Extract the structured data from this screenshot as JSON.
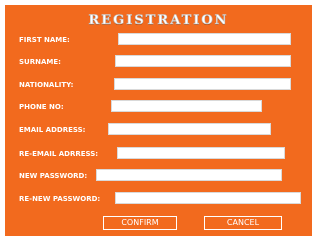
{
  "form": {
    "title": "REGISTRATION",
    "fields": [
      {
        "label": "FIRST NAME:",
        "value": ""
      },
      {
        "label": "SURNAME:",
        "value": ""
      },
      {
        "label": "NATIONALITY:",
        "value": ""
      },
      {
        "label": "PHONE NO:",
        "value": ""
      },
      {
        "label": "EMAIL ADDRESS:",
        "value": ""
      },
      {
        "label": "RE-EMAIL ADRRESS:",
        "value": ""
      },
      {
        "label": "NEW PASSWORD:",
        "value": ""
      },
      {
        "label": "RE-NEW PASSWORD:",
        "value": ""
      }
    ],
    "confirm_label": "CONFIRM",
    "cancel_label": "CANCEL"
  },
  "colors": {
    "panel_background": "#f26a1e",
    "text": "#ffffff",
    "page_background": "#ffffff"
  }
}
